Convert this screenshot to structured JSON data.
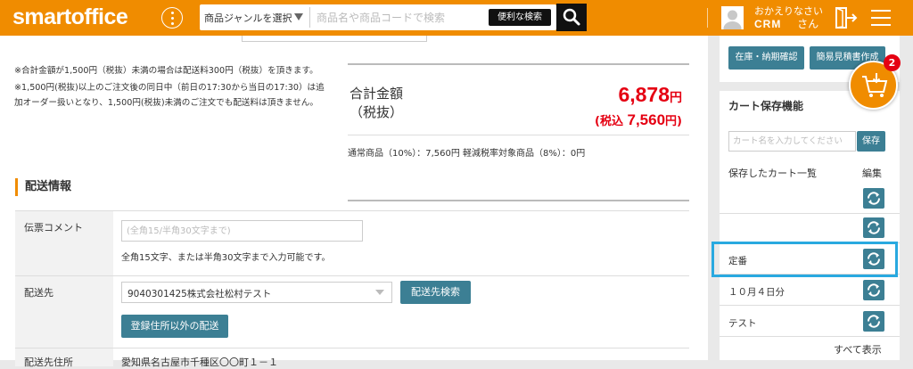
{
  "header": {
    "logo": "smartoffice",
    "genre_select": "商品ジャンルを選択",
    "search_placeholder": "商品名や商品コードで検索",
    "advanced_search": "便利な検索",
    "greeting": "おかえりなさい",
    "user_name": "CRM",
    "user_suffix": "さん",
    "brand_color": "#f08c00"
  },
  "notes": [
    "※合計金額が1,500円（税抜）未満の場合は配送料300円（税抜）を頂きます。",
    "※1,500円(税抜)以上のご注文後の同日中（前日の17:30から当日の17:30）は追",
    "加オーダー扱いとなり、1,500円(税抜)未満のご注文でも配送料は頂きません。"
  ],
  "total": {
    "label_line1": "合計金額",
    "label_line2": "（税抜）",
    "amount": "6,878",
    "yen": "円",
    "tax_label": "(税込",
    "tax_amount": "7,560",
    "tax_yen": "円)",
    "breakdown": "通常商品（10%）：7,560円 軽減税率対象商品（8%）：0円",
    "price_color": "#e50012"
  },
  "shipping": {
    "section_title": "配送情報",
    "comment_label": "伝票コメント",
    "comment_placeholder": "(全角15/半角30文字まで)",
    "comment_help": "全角15文字、または半角30文字まで入力可能です。",
    "destination_label": "配送先",
    "destination_value": "9040301425株式会社松村テスト",
    "destination_search": "配送先検索",
    "other_address": "登録住所以外の配送",
    "address_label": "配送先住所",
    "address_value": "愛知県名古屋市千種区〇〇町１－１"
  },
  "sidebar": {
    "stock_button": "在庫・納期確認",
    "estimate_button": "簡易見積書作成",
    "cart_title": "カート保存機能",
    "cart_name_placeholder": "カート名を入力してください",
    "save_button": "保存",
    "saved_title": "保存したカート一覧",
    "edit": "編集",
    "saved_carts": [
      {
        "label": ""
      },
      {
        "label": ""
      },
      {
        "label": "定番"
      },
      {
        "label": "１０月４日分"
      },
      {
        "label": "テスト"
      }
    ],
    "show_all": "すべて表示",
    "accent_color": "#3c7f94",
    "highlight_color": "#29a9e0"
  },
  "cart_fab": {
    "count": "2"
  }
}
